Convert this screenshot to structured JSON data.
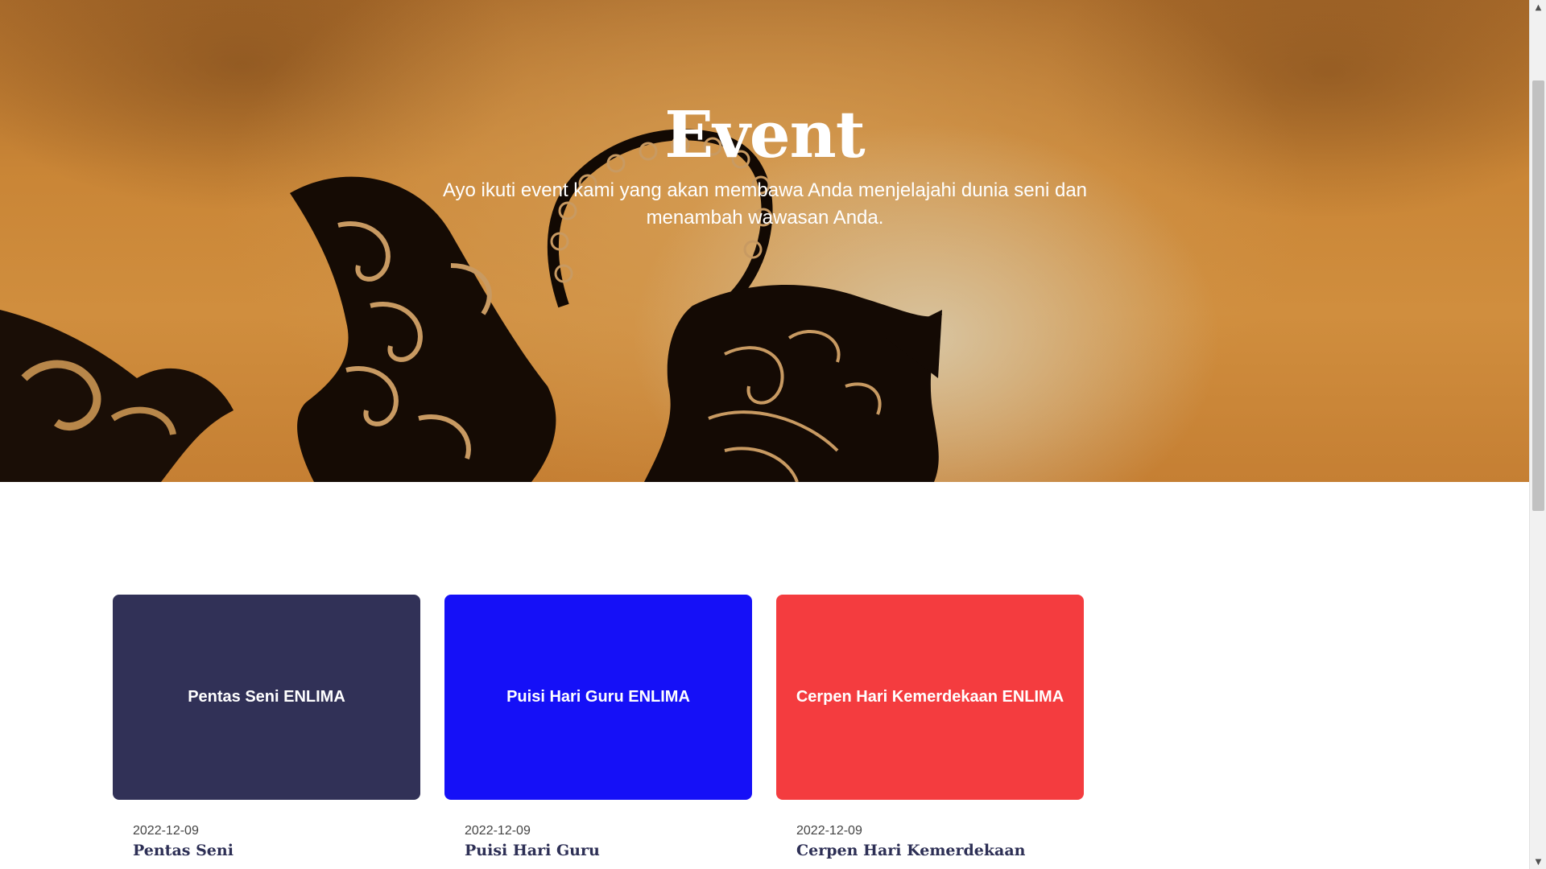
{
  "hero": {
    "title": "Event",
    "subtitle": "Ayo ikuti event kami yang akan membawa Anda menjelajahi dunia seni dan menambah wawasan Anda.",
    "background_icon": "wayang-silhouette-icon"
  },
  "events": [
    {
      "thumb_label": "Pentas Seni ENLIMA",
      "thumb_color": "#313157",
      "date": "2022-12-09",
      "title": "Pentas Seni"
    },
    {
      "thumb_label": "Puisi Hari Guru ENLIMA",
      "thumb_color": "#1510f7",
      "date": "2022-12-09",
      "title": "Puisi Hari Guru"
    },
    {
      "thumb_label": "Cerpen Hari Kemerdekaan ENLIMA",
      "thumb_color": "#f43c3f",
      "date": "2022-12-09",
      "title": "Cerpen Hari Kemerdekaan"
    }
  ],
  "scrollbar": {
    "up_icon": "chevron-up-icon",
    "down_icon": "chevron-down-icon"
  }
}
